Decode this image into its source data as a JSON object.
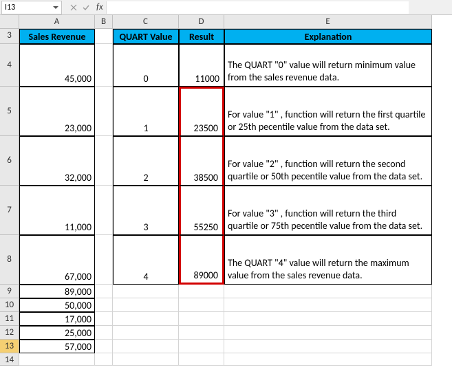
{
  "nameBox": "I13",
  "fxLabel": "fx",
  "formula": "",
  "colHeaders": [
    "A",
    "B",
    "C",
    "D",
    "E"
  ],
  "rowHeaders": [
    "3",
    "4",
    "5",
    "6",
    "7",
    "8",
    "9",
    "10",
    "11",
    "12",
    "13",
    "14"
  ],
  "headerRow": {
    "a": "Sales Revenue",
    "c": "QUART Value",
    "d": "Result",
    "e": "Explanation"
  },
  "rows": [
    {
      "a": "45,000",
      "c": "0",
      "d": "11000",
      "e": "The QUART \"0\" value will return minimum value from the sales revenue data."
    },
    {
      "a": "23,000",
      "c": "1",
      "d": "23500",
      "e": "For value \"1\" , function will return the first quartile or 25th pecentile value from the data set."
    },
    {
      "a": "32,000",
      "c": "2",
      "d": "38500",
      "e": "For value \"2\" , function will return the second quartile or 50th pecentile value from the data set."
    },
    {
      "a": "11,000",
      "c": "3",
      "d": "55250",
      "e": "For value \"3\" , function will return the third quartile or 75th pecentile value from the data set."
    },
    {
      "a": "67,000",
      "c": "4",
      "d": "89000",
      "e": "The QUART \"4\" value will return the maximum value from the sales revenue data."
    }
  ],
  "extraA": [
    "89,000",
    "50,000",
    "17,000",
    "25,000",
    "57,000"
  ],
  "selectedRow": "13"
}
